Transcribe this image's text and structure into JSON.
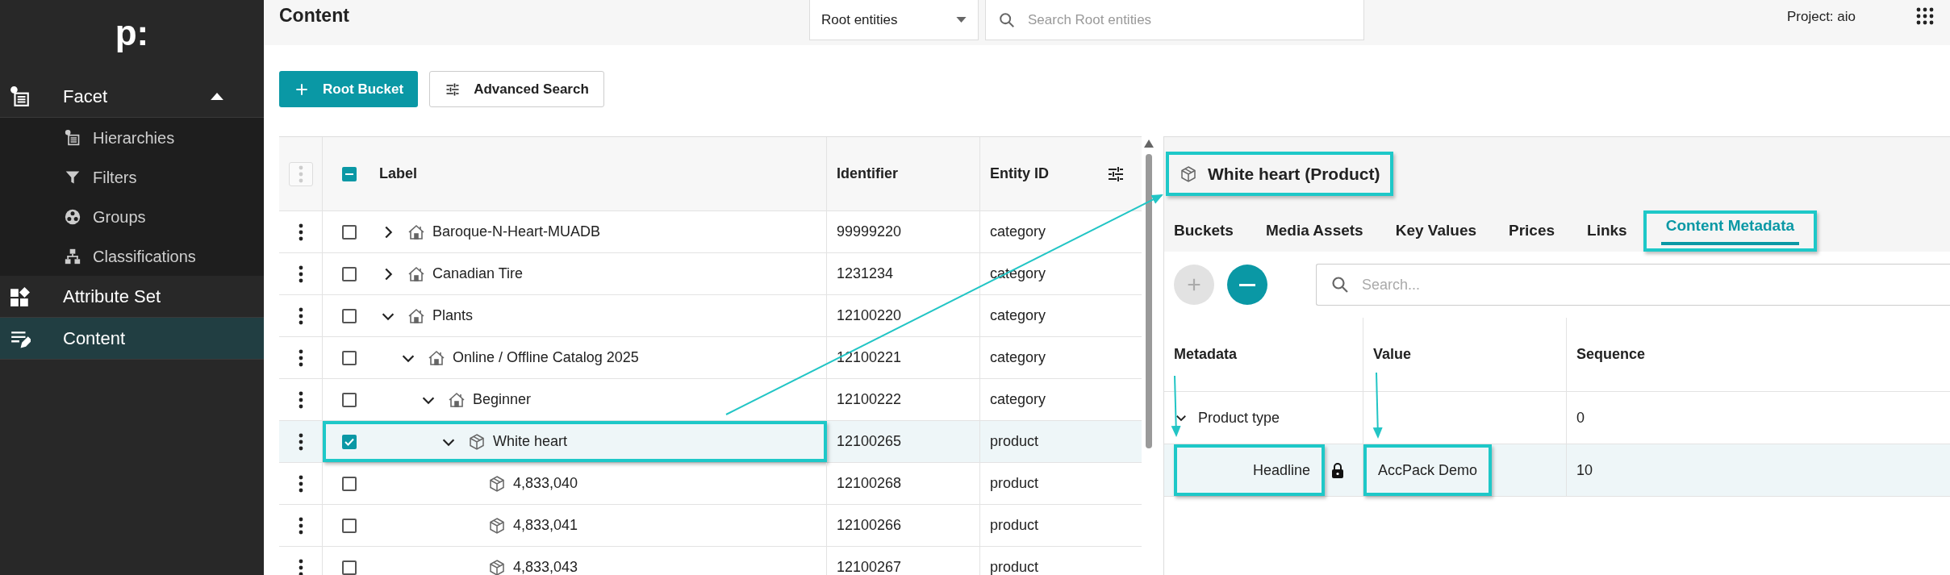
{
  "sidebar": {
    "logo": "p:",
    "items": [
      {
        "label": "Facet",
        "selected": false,
        "expanded": true,
        "children": [
          {
            "label": "Hierarchies",
            "selected": false
          },
          {
            "label": "Filters",
            "selected": false
          },
          {
            "label": "Groups",
            "selected": false
          },
          {
            "label": "Classifications",
            "selected": false
          }
        ]
      },
      {
        "label": "Attribute Set",
        "selected": false
      },
      {
        "label": "Content",
        "selected": true
      }
    ]
  },
  "header": {
    "title": "Content",
    "scope_dropdown": {
      "value": "Root entities"
    },
    "search": {
      "placeholder": "Search Root entities"
    },
    "project": "Project: aio"
  },
  "toolbar": {
    "buttons": [
      {
        "label": "Root Bucket",
        "kind": "primary"
      },
      {
        "label": "Advanced Search",
        "kind": "outline"
      }
    ]
  },
  "tree_table": {
    "select_all": {
      "indeterminate": true
    },
    "columns": [
      "Label",
      "Identifier",
      "Entity ID"
    ],
    "rows": [
      {
        "label": "Baroque-N-Heart-MUADB",
        "kind": "category",
        "identifier": "99999220",
        "entity_id": "category",
        "checked": false,
        "highlighted": false,
        "expanded": false
      },
      {
        "label": "Canadian Tire",
        "kind": "category",
        "identifier": "1231234",
        "entity_id": "category",
        "checked": false,
        "highlighted": false,
        "expanded": false
      },
      {
        "label": "Plants",
        "kind": "category",
        "identifier": "12100220",
        "entity_id": "category",
        "checked": false,
        "highlighted": false,
        "expanded": true,
        "children": [
          {
            "label": "Online / Offline Catalog 2025",
            "kind": "category",
            "identifier": "12100221",
            "entity_id": "category",
            "checked": false,
            "highlighted": false,
            "expanded": true,
            "children": [
              {
                "label": "Beginner",
                "kind": "category",
                "identifier": "12100222",
                "entity_id": "category",
                "checked": false,
                "highlighted": false,
                "expanded": true,
                "children": [
                  {
                    "label": "White heart",
                    "kind": "product",
                    "identifier": "12100265",
                    "entity_id": "product",
                    "checked": true,
                    "highlighted": true,
                    "expanded": true,
                    "children": [
                      {
                        "label": "4,833,040",
                        "kind": "product",
                        "identifier": "12100268",
                        "entity_id": "product",
                        "checked": false,
                        "highlighted": false
                      },
                      {
                        "label": "4,833,041",
                        "kind": "product",
                        "identifier": "12100266",
                        "entity_id": "product",
                        "checked": false,
                        "highlighted": false
                      },
                      {
                        "label": "4,833,043",
                        "kind": "product",
                        "identifier": "12100267",
                        "entity_id": "product",
                        "checked": false,
                        "highlighted": false
                      }
                    ]
                  }
                ]
              }
            ]
          }
        ]
      }
    ]
  },
  "detail": {
    "title": "White heart (Product)",
    "highlighted": true,
    "tabs": [
      {
        "label": "Buckets",
        "selected": false,
        "highlighted": false
      },
      {
        "label": "Media Assets",
        "selected": false,
        "highlighted": false
      },
      {
        "label": "Key Values",
        "selected": false,
        "highlighted": false
      },
      {
        "label": "Prices",
        "selected": false,
        "highlighted": false
      },
      {
        "label": "Links",
        "selected": false,
        "highlighted": false
      },
      {
        "label": "Content Metadata",
        "selected": true,
        "highlighted": true
      }
    ],
    "add_button": {
      "disabled": true
    },
    "remove_button": {
      "disabled": false
    },
    "search": {
      "placeholder": "Search..."
    },
    "columns": [
      "Metadata",
      "Value",
      "Sequence"
    ],
    "rows": [
      {
        "name": "Product type",
        "sequence": "0",
        "selected": false,
        "highlighted": false,
        "expanded": true,
        "children": [
          {
            "name": "Headline",
            "locked": true,
            "value": "AccPack Demo",
            "sequence": "10",
            "selected": true,
            "highlighted": true
          }
        ]
      }
    ]
  }
}
